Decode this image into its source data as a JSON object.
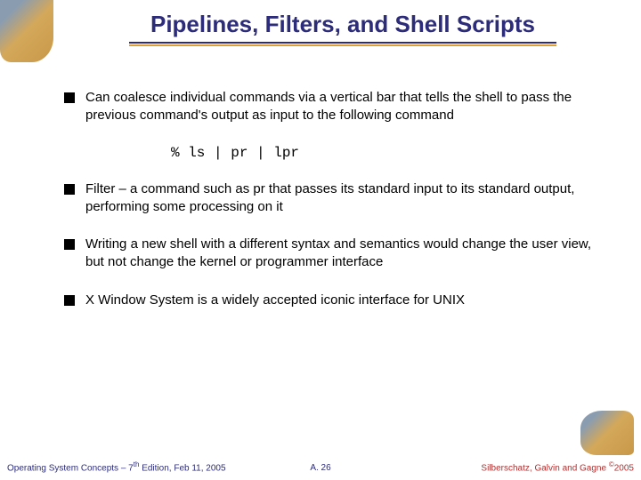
{
  "title": "Pipelines, Filters, and Shell Scripts",
  "bullets": [
    "Can coalesce individual commands via a vertical bar that tells the shell to pass the previous command's output as input to the following command",
    "Filter – a command such as pr that passes its standard input to its standard output, performing some processing on it",
    "Writing a new shell with a different syntax and semantics would change the user view, but not change the kernel or programmer interface",
    "X Window System is a widely accepted iconic interface for UNIX"
  ],
  "code": "% ls | pr | lpr",
  "footer": {
    "left_prefix": "Operating System Concepts – 7",
    "left_suffix": " Edition, Feb 11, 2005",
    "left_sup": "th",
    "center": "A. 26",
    "right_prefix": "Silberschatz, Galvin and Gagne ",
    "right_sup": "©",
    "right_suffix": "2005"
  }
}
